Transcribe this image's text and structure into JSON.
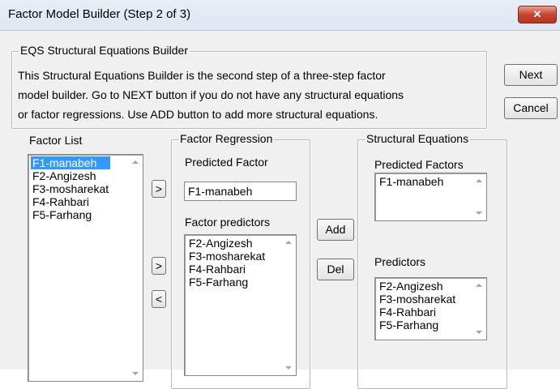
{
  "window": {
    "title": "Factor Model Builder (Step 2 of 3)",
    "close_icon": "close-icon",
    "close_glyph": "✕"
  },
  "intro": {
    "group_title": "EQS Structural Equations Builder",
    "lines": [
      "This Structural Equations Builder is the second step of a three-step factor",
      "model builder.  Go to NEXT button if you do not have any structural equations",
      "or factor regressions.  Use ADD button to add more structural equations."
    ]
  },
  "buttons": {
    "next": "Next",
    "cancel": "Cancel",
    "move_predicted": ">",
    "move_predictor": ">",
    "remove_predictor": "<",
    "add": "Add",
    "del": "Del"
  },
  "factor_list": {
    "label": "Factor List",
    "items": [
      "F1-manabeh",
      "F2-Angizesh",
      "F3-mosharekat",
      "F4-Rahbari",
      "F5-Farhang"
    ],
    "selected_index": 0
  },
  "factor_regression": {
    "group_title": "Factor Regression",
    "predicted_label": "Predicted Factor",
    "predicted_value": "F1-manabeh",
    "predictors_label": "Factor predictors",
    "predictors": [
      "F2-Angizesh",
      "F3-mosharekat",
      "F4-Rahbari",
      "F5-Farhang"
    ]
  },
  "structural_equations": {
    "group_title": "Structural Equations",
    "predicted_label": "Predicted Factors",
    "predicted_items": [
      "F1-manabeh"
    ],
    "predictors_label": "Predictors",
    "predictors": [
      "F2-Angizesh",
      "F3-mosharekat",
      "F4-Rahbari",
      "F5-Farhang"
    ]
  },
  "colors": {
    "selection": "#3399ff",
    "dialog_bg": "#f0f0f0",
    "close_button": "#c8452f"
  }
}
